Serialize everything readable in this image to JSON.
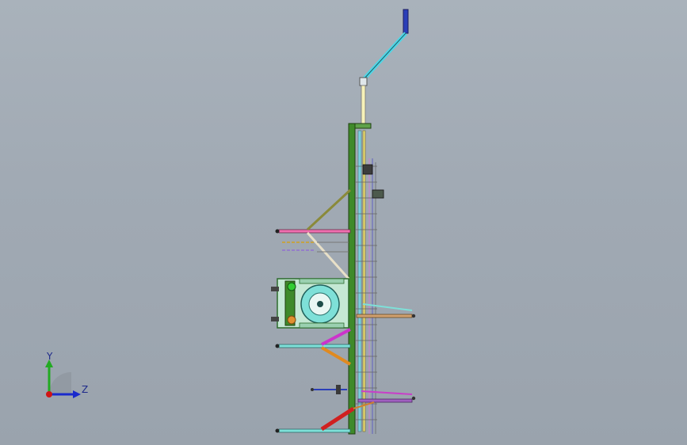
{
  "viewport": {
    "background_top": "#a9b2bb",
    "background_bottom": "#9aa3ad"
  },
  "triad": {
    "y_label": "Y",
    "z_label": "Z",
    "y_color": "#22aa22",
    "z_color": "#1a2acc",
    "origin_color": "#d01515"
  },
  "model": {
    "description_icon": "cad-assembly-side-view",
    "frame_color": "#3f8a2a",
    "pipe_color": "#4fd6e6"
  }
}
